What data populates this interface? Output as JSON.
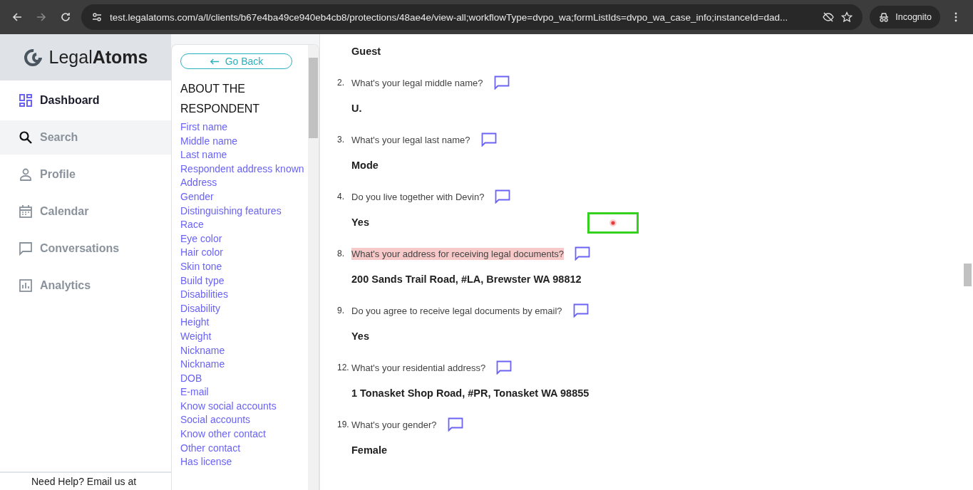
{
  "browser": {
    "url": "test.legalatoms.com/a/l/clients/b67e4ba49ce940eb4cb8/protections/48ae4e/view-all;workflowType=dvpo_wa;formListIds=dvpo_wa_case_info;instanceId=dad...",
    "profile": "Incognito"
  },
  "logo": {
    "light": "Legal",
    "bold": "Atoms"
  },
  "nav": [
    {
      "label": "Dashboard",
      "kind": "dashboard",
      "selected": true,
      "hovered": false
    },
    {
      "label": "Search",
      "kind": "search",
      "selected": false,
      "hovered": true
    },
    {
      "label": "Profile",
      "kind": "profile",
      "selected": false,
      "hovered": false
    },
    {
      "label": "Calendar",
      "kind": "calendar",
      "selected": false,
      "hovered": false
    },
    {
      "label": "Conversations",
      "kind": "chat",
      "selected": false,
      "hovered": false
    },
    {
      "label": "Analytics",
      "kind": "analytics",
      "selected": false,
      "hovered": false
    }
  ],
  "help_text": "Need Help? Email us at",
  "outline": {
    "back_button": "Go Back",
    "section_title": "ABOUT THE RESPONDENT",
    "links": [
      "First name",
      "Middle name",
      "Last name",
      "Respondent address known",
      "Address",
      "Gender",
      "Distinguishing features",
      "Race",
      "Eye color",
      "Hair color",
      "Skin tone",
      "Build type",
      "Disabilities",
      "Disability",
      "Height",
      "Weight",
      "Nickname",
      "Nickname",
      "DOB",
      "E-mail",
      "Know social accounts",
      "Social accounts",
      "Know other contact",
      "Other contact",
      "Has license"
    ]
  },
  "first_answer": "Guest",
  "questions": [
    {
      "number": "2.",
      "text": "What's your legal middle name?",
      "answer": "U.",
      "highlighted": false
    },
    {
      "number": "3.",
      "text": "What's your legal last name?",
      "answer": "Mode",
      "highlighted": false
    },
    {
      "number": "4.",
      "text": "Do you live together with Devin?",
      "answer": "Yes",
      "highlighted": false
    },
    {
      "number": "8.",
      "text": "What's your address for receiving legal documents?",
      "answer": "200 Sands Trail Road, #LA, Brewster WA 98812",
      "highlighted": true
    },
    {
      "number": "9.",
      "text": "Do you agree to receive legal documents by email?",
      "answer": "Yes",
      "highlighted": false
    },
    {
      "number": "12.",
      "text": "What's your residential address?",
      "answer": "1 Tonasket Shop Road, #PR, Tonasket WA 98855",
      "highlighted": false
    },
    {
      "number": "19.",
      "text": "What's your gender?",
      "answer": "Female",
      "highlighted": false
    }
  ]
}
